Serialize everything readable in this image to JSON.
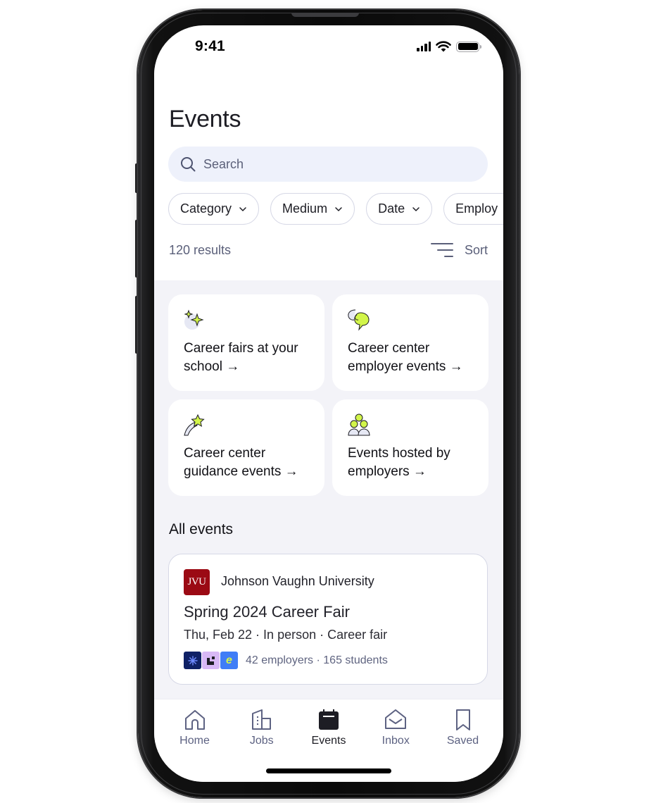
{
  "status_bar": {
    "time": "9:41",
    "icons": [
      "cellular-signal-icon",
      "wifi-icon",
      "battery-icon"
    ]
  },
  "header": {
    "title": "Events",
    "search": {
      "placeholder": "Search",
      "value": "",
      "icon": "search-icon"
    },
    "filters": [
      {
        "label": "Category",
        "icon": "chevron-down-icon"
      },
      {
        "label": "Medium",
        "icon": "chevron-down-icon"
      },
      {
        "label": "Date",
        "icon": "chevron-down-icon"
      },
      {
        "label": "Employ",
        "icon": "chevron-down-icon"
      }
    ],
    "results_count": "120 results",
    "sort_label": "Sort"
  },
  "categories": [
    {
      "label": "Career fairs at your school →",
      "icon": "sparkles-icon"
    },
    {
      "label": "Career center employer events →",
      "icon": "speech-bubble-icon"
    },
    {
      "label": "Career center guidance events →",
      "icon": "shooting-star-icon"
    },
    {
      "label": "Events hosted by employers →",
      "icon": "people-group-icon"
    }
  ],
  "all_events": {
    "title": "All events",
    "items": [
      {
        "org_logo_text": "JVU",
        "org_name": "Johnson Vaughn University",
        "title": "Spring 2024 Career Fair",
        "meta": "Thu, Feb 22 · In person · Career fair",
        "employer_logos": [
          "sunburst-logo",
          "block-logo",
          "e-logo"
        ],
        "employer_logo_letter": "e",
        "stats": "42 employers · 165 students"
      }
    ]
  },
  "colors": {
    "accent_lime": "#d2f54a",
    "org_red": "#9b0a14",
    "text_muted": "#5d6282",
    "search_bg": "#eef1fb"
  },
  "tab_bar": {
    "active": "Events",
    "tabs": [
      {
        "label": "Home",
        "icon": "home-icon"
      },
      {
        "label": "Jobs",
        "icon": "building-icon"
      },
      {
        "label": "Events",
        "icon": "calendar-icon"
      },
      {
        "label": "Inbox",
        "icon": "envelope-open-icon"
      },
      {
        "label": "Saved",
        "icon": "bookmark-icon"
      }
    ]
  }
}
